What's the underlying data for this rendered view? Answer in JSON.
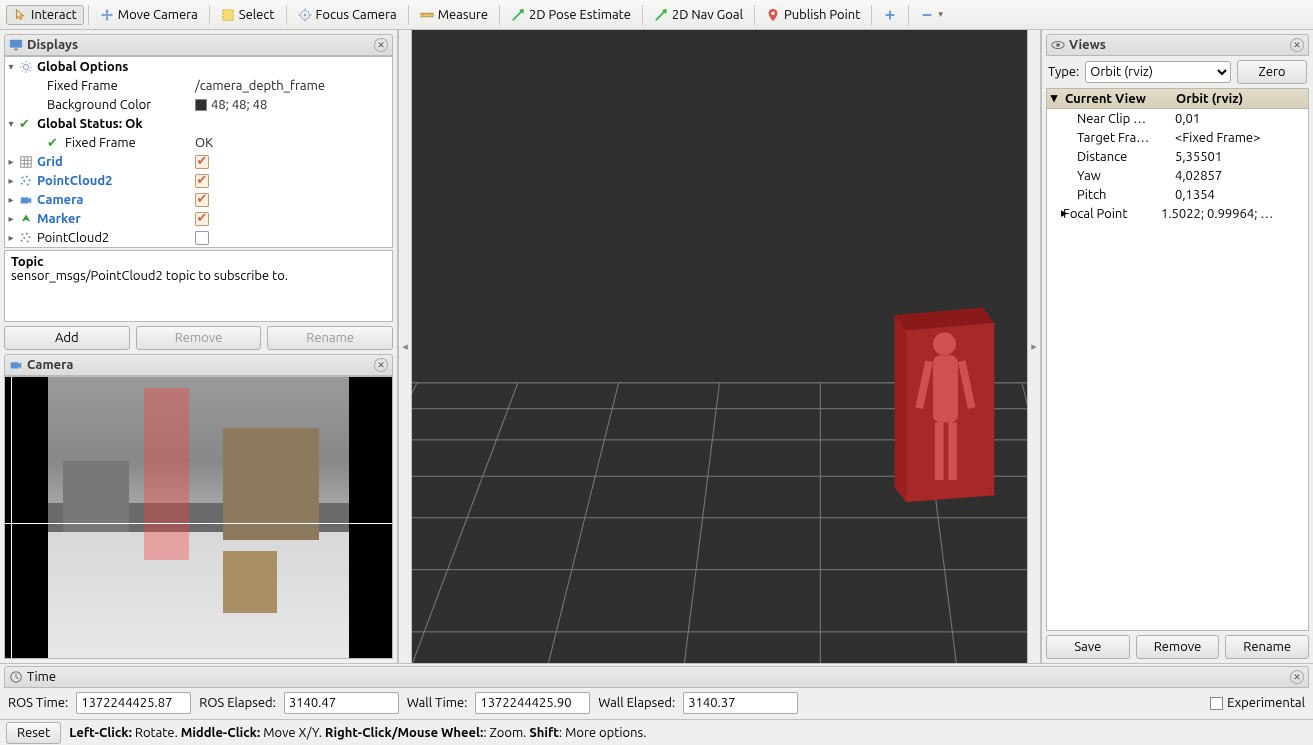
{
  "toolbar": {
    "interact": "Interact",
    "move_camera": "Move Camera",
    "select": "Select",
    "focus_camera": "Focus Camera",
    "measure": "Measure",
    "pose_estimate": "2D Pose Estimate",
    "nav_goal": "2D Nav Goal",
    "publish_point": "Publish Point"
  },
  "displays": {
    "title": "Displays",
    "global_options": "Global Options",
    "fixed_frame_lbl": "Fixed Frame",
    "fixed_frame_val": "/camera_depth_frame",
    "background_color_lbl": "Background Color",
    "background_color_val": "48; 48; 48",
    "global_status": "Global Status: Ok",
    "fixed_frame_status_lbl": "Fixed Frame",
    "fixed_frame_status_val": "OK",
    "grid": "Grid",
    "pointcloud2_a": "PointCloud2",
    "camera": "Camera",
    "marker": "Marker",
    "pointcloud2_b": "PointCloud2",
    "desc_title": "Topic",
    "desc_body": "sensor_msgs/PointCloud2 topic to subscribe to.",
    "add": "Add",
    "remove": "Remove",
    "rename": "Rename"
  },
  "camera_panel": {
    "title": "Camera"
  },
  "views": {
    "title": "Views",
    "type_lbl": "Type:",
    "type_val": "Orbit (rviz)",
    "zero": "Zero",
    "col1": "Current View",
    "col2": "Orbit (rviz)",
    "near_clip_lbl": "Near Clip …",
    "near_clip_val": "0,01",
    "target_frame_lbl": "Target Fra…",
    "target_frame_val": "<Fixed Frame>",
    "distance_lbl": "Distance",
    "distance_val": "5,35501",
    "yaw_lbl": "Yaw",
    "yaw_val": "4,02857",
    "pitch_lbl": "Pitch",
    "pitch_val": "0,1354",
    "focal_lbl": "Focal Point",
    "focal_val": "1.5022; 0.99964; …",
    "save": "Save",
    "remove": "Remove",
    "rename": "Rename"
  },
  "time": {
    "title": "Time",
    "ros_time_lbl": "ROS Time:",
    "ros_time_val": "1372244425.87",
    "ros_elapsed_lbl": "ROS Elapsed:",
    "ros_elapsed_val": "3140.47",
    "wall_time_lbl": "Wall Time:",
    "wall_time_val": "1372244425.90",
    "wall_elapsed_lbl": "Wall Elapsed:",
    "wall_elapsed_val": "3140.37",
    "experimental": "Experimental"
  },
  "status": {
    "reset": "Reset",
    "left": "Left-Click:",
    "left_v": " Rotate. ",
    "middle": "Middle-Click:",
    "middle_v": " Move X/Y. ",
    "right": "Right-Click/Mouse Wheel:",
    "right_v": ": Zoom. ",
    "shift": "Shift",
    "shift_v": ": More options."
  }
}
